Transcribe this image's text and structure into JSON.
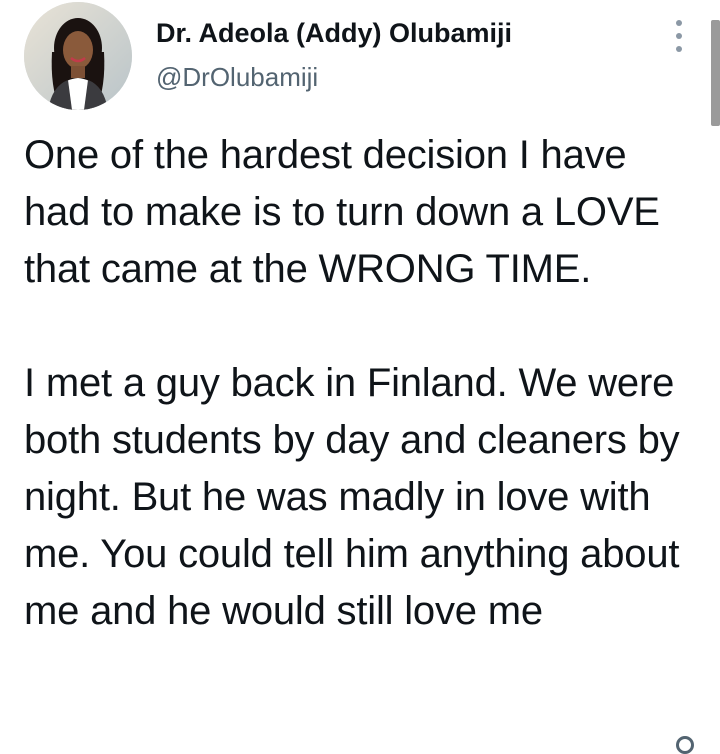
{
  "author": {
    "name": "Dr. Adeola (Addy) Olubamiji",
    "handle": "@DrOlubamiji"
  },
  "tweet": {
    "paragraphs": [
      "One of the hardest decision I have had to make is to turn down a LOVE that came at the WRONG TIME.",
      "I met a guy back in Finland. We were both students by day and cleaners by night. But he was madly in love with me. You could tell him anything about me and he would still love me"
    ]
  },
  "icons": {
    "more": "more-vertical-icon",
    "corner": "reply-icon"
  },
  "colors": {
    "text": "#0f1419",
    "secondary_text": "#536471",
    "background": "#ffffff"
  }
}
